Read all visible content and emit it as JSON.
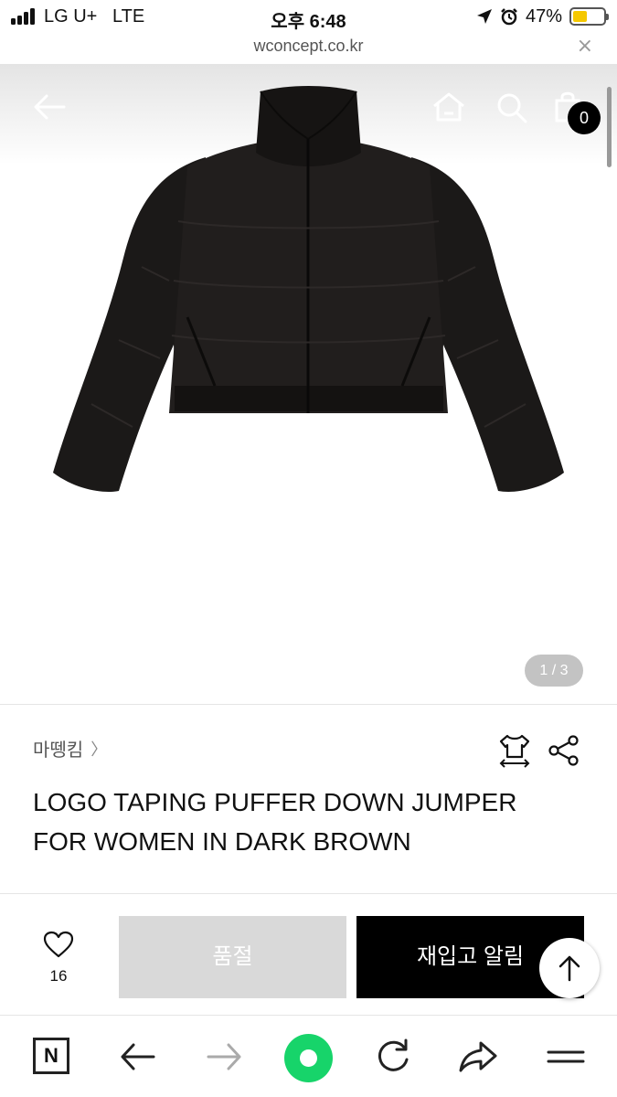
{
  "status_bar": {
    "carrier": "LG U+",
    "network": "LTE",
    "time": "오후 6:48",
    "battery_percent": "47%",
    "battery_level": 0.47
  },
  "url_bar": {
    "url": "wconcept.co.kr",
    "close_glyph": "×"
  },
  "hero": {
    "cart_count": "0",
    "image_counter": "1 / 3"
  },
  "product": {
    "brand": "마뗑킴",
    "brand_chevron": "〉",
    "title_line1": "LOGO TAPING PUFFER DOWN JUMPER",
    "title_line2": "FOR WOMEN IN DARK BROWN"
  },
  "actions": {
    "like_count": "16",
    "soldout_label": "품절",
    "restock_label": "재입고 알림"
  },
  "bottom_bar": {
    "n_logo": "N"
  },
  "colors": {
    "accent_green": "#17d46a",
    "soldout_gray": "#d9d9d9",
    "primary_black": "#000000",
    "battery_yellow": "#f5c800"
  },
  "icons": [
    "back-arrow-icon",
    "home-icon",
    "search-icon",
    "cart-icon",
    "size-chart-icon",
    "share-icon",
    "heart-icon",
    "arrow-up-icon",
    "back-icon",
    "forward-icon",
    "reload-icon",
    "share-out-icon",
    "menu-icon"
  ]
}
